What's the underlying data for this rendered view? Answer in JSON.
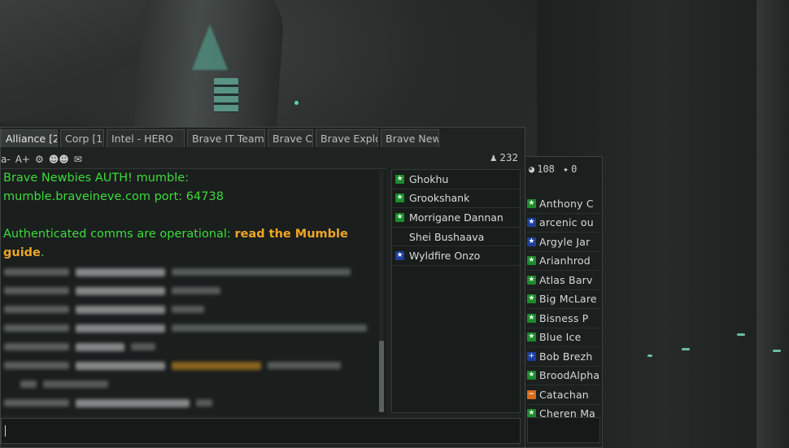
{
  "chat_window": {
    "tabs": [
      {
        "label": "Alliance [2",
        "active": true
      },
      {
        "label": "Corp [1",
        "active": false
      },
      {
        "label": "Intel - HERO",
        "active": false
      },
      {
        "label": "Brave IT Team",
        "active": false
      },
      {
        "label": "Brave C",
        "active": false
      },
      {
        "label": "Brave Explo",
        "active": false
      },
      {
        "label": "Brave New",
        "active": false
      }
    ],
    "toolbar": {
      "font_smaller": "a-",
      "font_larger": "A+",
      "member_count": "232"
    },
    "motd": {
      "line1": "Brave Newbies AUTH! mumble:",
      "line2": "mumble.braveineve.com port: 64738",
      "line3_prefix": "Authenticated comms are operational: ",
      "line3_link": "read the Mumble guide",
      "line3_suffix": "."
    },
    "members": [
      {
        "name": "Ghokhu",
        "icon": "green-star"
      },
      {
        "name": "Grookshank",
        "icon": "green-star"
      },
      {
        "name": "Morrigane Dannan",
        "icon": "green-star"
      },
      {
        "name": "Shei Bushaava",
        "icon": "none"
      },
      {
        "name": "Wyldfire Onzo",
        "icon": "blue-star"
      }
    ]
  },
  "side_panel": {
    "count_a": "108",
    "count_b": "0",
    "members": [
      {
        "name": "Anthony C",
        "icon": "green-star"
      },
      {
        "name": "arcenic ou",
        "icon": "blue-star"
      },
      {
        "name": "Argyle Jar",
        "icon": "blue-star"
      },
      {
        "name": "Arianhrod",
        "icon": "green-star"
      },
      {
        "name": "Atlas Barv",
        "icon": "green-star"
      },
      {
        "name": "Big McLare",
        "icon": "green-star"
      },
      {
        "name": "Bisness P",
        "icon": "green-star"
      },
      {
        "name": "Blue Ice",
        "icon": "green-star"
      },
      {
        "name": "Bob Brezh",
        "icon": "blue-plus"
      },
      {
        "name": "BroodAlpha",
        "icon": "green-star"
      },
      {
        "name": "Catachan",
        "icon": "orange-minus"
      },
      {
        "name": "Cheren Ma",
        "icon": "green-star"
      }
    ]
  },
  "colors": {
    "motd_green": "#3ddb3d",
    "link_orange": "#f0a525",
    "standing_green": "#1e8a2c",
    "standing_blue": "#1c3f9a",
    "standing_orange": "#d86a1a"
  }
}
